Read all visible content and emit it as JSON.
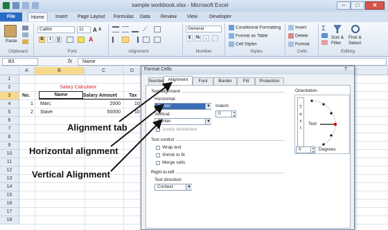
{
  "window": {
    "title": "sample workbook.xlsx - Microsoft Excel",
    "minimize_glyph": "–",
    "maximize_glyph": "□",
    "close_glyph": "✕"
  },
  "tabs": [
    "File",
    "Home",
    "Insert",
    "Page Layout",
    "Formulas",
    "Data",
    "Review",
    "View",
    "Developer"
  ],
  "ribbon": {
    "paste_label": "Paste",
    "font_name": "Calibri",
    "font_size": "11",
    "bold": "B",
    "italic": "I",
    "underline": "U",
    "number_format": "General",
    "currency": "$",
    "percent": "%",
    "comma": ",",
    "conditional_formatting": "Conditional Formatting",
    "format_as_table": "Format as Table",
    "cell_styles": "Cell Styles",
    "insert": "Insert",
    "delete": "Delete",
    "format": "Format",
    "sort_filter": "Sort &",
    "sort_filter_2": "Filter",
    "find_select": "Find &",
    "find_select_2": "Select",
    "groups": {
      "clipboard": "Clipboard",
      "font": "Font",
      "alignment": "Alignment",
      "number": "Number",
      "styles": "Styles",
      "cells": "Cells",
      "editing": "Editing"
    }
  },
  "formula_bar": {
    "name_box": "B3",
    "fx": "fx",
    "content": "Name"
  },
  "sheet": {
    "columns": [
      "A",
      "B",
      "C",
      "D"
    ],
    "rows": [
      "1",
      "2",
      "3",
      "4",
      "5",
      "6",
      "7",
      "8",
      "9",
      "10",
      "11",
      "12",
      "13",
      "14",
      "15",
      "16",
      "17",
      "18"
    ],
    "title": "Salary Calculator",
    "headers": {
      "no": "No.",
      "name": "Name",
      "salary": "Salary Amount",
      "tax": "Tax"
    },
    "data": [
      {
        "no": "1",
        "name": "Marc",
        "salary": "2000",
        "tax": "10"
      },
      {
        "no": "2",
        "name": "Stave",
        "salary": "50000",
        "tax": "10"
      }
    ],
    "title_color": "#d9252a"
  },
  "dialog": {
    "title": "Format Cells",
    "tabs": [
      "Number",
      "Alignment",
      "Font",
      "Border",
      "Fill",
      "Protection"
    ],
    "text_alignment": "Text alignment",
    "horizontal_label": "Horizontal:",
    "horizontal_value": "Center",
    "indent_label": "Indent:",
    "indent_value": "0",
    "vertical_label": "Vertical:",
    "vertical_value": "Center",
    "justify_distributed": "Justify distributed",
    "text_control": "Text control",
    "wrap_text": "Wrap text",
    "shrink_to_fit": "Shrink to fit",
    "merge_cells": "Merge cells",
    "rtl": "Right-to-left",
    "text_direction_label": "Text direction:",
    "text_direction_value": "Context",
    "orientation": "Orientation",
    "orientation_text": "Text",
    "vertical_text": [
      "T",
      "e",
      "x",
      "t"
    ],
    "degrees_value": "0",
    "degrees_label": "Degrees"
  },
  "annotations": {
    "alignment_tab": "Alignment tab",
    "horizontal": "Horizontal alignment",
    "vertical": "Vertical Alignment"
  }
}
